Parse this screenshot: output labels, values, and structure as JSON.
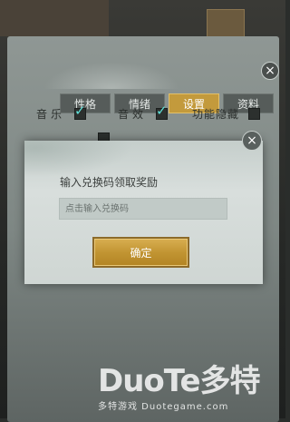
{
  "settings_panel": {
    "tabs": [
      {
        "label": "性格"
      },
      {
        "label": "情绪"
      },
      {
        "label": "设置",
        "active": true
      },
      {
        "label": "资料"
      }
    ],
    "options": {
      "music": {
        "label": "音乐",
        "checked": true
      },
      "sound_effects": {
        "label": "音效",
        "checked": true
      },
      "hide_function": {
        "label": "功能隐藏",
        "checked": false
      }
    },
    "close_icon": "close-icon"
  },
  "dialog": {
    "title": "输入兑换码领取奖励",
    "code_input": {
      "value": "",
      "placeholder": "点击输入兑换码"
    },
    "confirm_label": "确定",
    "close_icon": "close-icon"
  },
  "watermark": {
    "brand": "DuoTe多特",
    "sub": "多特游戏 Duotegame.com"
  },
  "colors": {
    "accent_gold": "#c39a3c",
    "check_cyan": "#5fe0d8"
  }
}
